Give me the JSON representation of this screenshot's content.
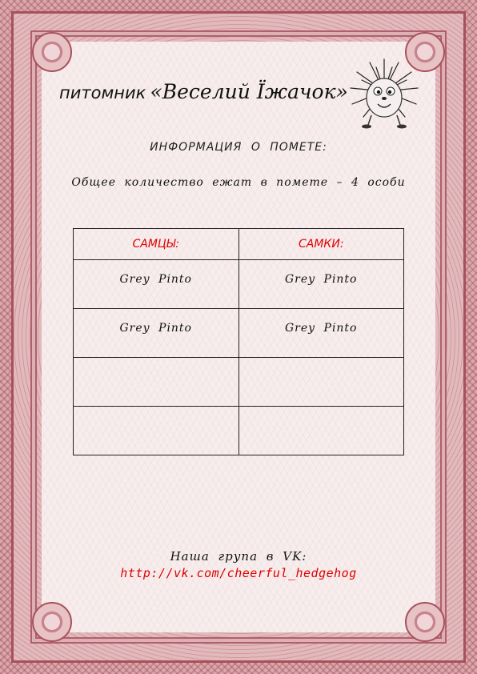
{
  "kennel": {
    "prefix": "питомник",
    "name": "«Веселий Ïжачок»"
  },
  "heading": "ИНФОРМАЦИЯ О ПОМЕТЕ:",
  "total_text": "Общее количество ежат в помете – 4 особи",
  "table": {
    "columns": [
      "САМЦЫ:",
      "САМКИ:"
    ],
    "rows": [
      [
        "Grey Pinto",
        "Grey Pinto"
      ],
      [
        "Grey Pinto",
        "Grey Pinto"
      ],
      [
        "",
        ""
      ],
      [
        "",
        ""
      ]
    ]
  },
  "vk": {
    "label": "Наша група в VK:",
    "link": "http://vk.com/cheerful_hedgehog"
  },
  "colors": {
    "frame": "#a8505c",
    "accent_red": "#e00000",
    "paper": "#f7eded"
  },
  "icons": [
    "hedgehog-icon"
  ]
}
